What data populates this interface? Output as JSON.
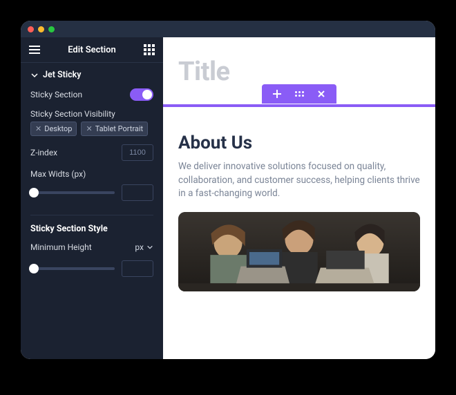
{
  "titlebar": {
    "dots": [
      "#ff5f57",
      "#febc2e",
      "#28c840"
    ]
  },
  "sidebar": {
    "header_title": "Edit Section",
    "accordion": "Jet Sticky",
    "sticky_section_label": "Sticky Section",
    "visibility_label": "Sticky Section Visibility",
    "visibility_tags": [
      "Desktop",
      "Tablet Portrait"
    ],
    "zindex_label": "Z-index",
    "zindex_value": "1100",
    "maxwidth_label": "Max Widts (px)",
    "maxwidth_value": "",
    "style_section": "Sticky Section Style",
    "minheight_label": "Minimum Height",
    "minheight_unit": "px",
    "minheight_value": ""
  },
  "canvas": {
    "title_placeholder": "Title",
    "heading": "About Us",
    "body": "We deliver innovative solutions focused on quality, collaboration, and customer success, helping clients thrive in a fast-changing world."
  }
}
